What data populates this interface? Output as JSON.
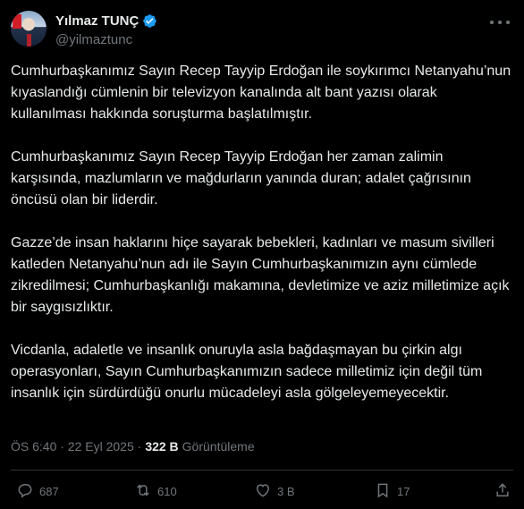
{
  "author": {
    "display_name": "Yılmaz TUNÇ",
    "handle": "@yilmaztunc"
  },
  "tweet": {
    "paragraphs": [
      "Cumhurbaşkanımız Sayın Recep Tayyip Erdoğan ile soykırımcı Netanyahu’nun kıyaslandığı cümlenin bir televizyon kanalında alt bant yazısı olarak kullanılması hakkında soruşturma başlatılmıştır.",
      "Cumhurbaşkanımız Sayın Recep Tayyip Erdoğan her zaman zalimin karşısında, mazlumların ve mağdurların yanında duran; adalet çağrısının öncüsü olan bir liderdir.",
      "Gazze’de insan haklarını hiçe sayarak bebekleri, kadınları ve masum sivilleri katleden Netanyahu’nun adı ile Sayın Cumhurbaşkanımızın aynı cümlede zikredilmesi; Cumhurbaşkanlığı makamına, devletimize ve aziz milletimize açık bir saygısızlıktır.",
      "Vicdanla, adaletle ve insanlık onuruyla asla bağdaşmayan bu çirkin algı operasyonları, Sayın Cumhurbaşkanımızın sadece milletimiz için değil tüm insanlık için sürdürdüğü onurlu mücadeleyi asla gölgeleyemeyecektir."
    ],
    "timestamp": "ÖS 6:40 · 22 Eyl 2025 ·",
    "views_count": "322 B",
    "views_label": "Görüntüleme"
  },
  "actions": {
    "replies": "687",
    "reposts": "610",
    "likes": "3 B",
    "bookmarks": "17"
  },
  "icons": {
    "verified": "verified-badge-icon",
    "more": "more-icon",
    "reply": "reply-icon",
    "repost": "repost-icon",
    "like": "like-icon",
    "bookmark": "bookmark-icon",
    "share": "share-icon"
  },
  "colors": {
    "background": "#000000",
    "text": "#e7e9ea",
    "muted": "#71767b",
    "verified": "#1d9bf0",
    "divider": "#2f3336"
  }
}
